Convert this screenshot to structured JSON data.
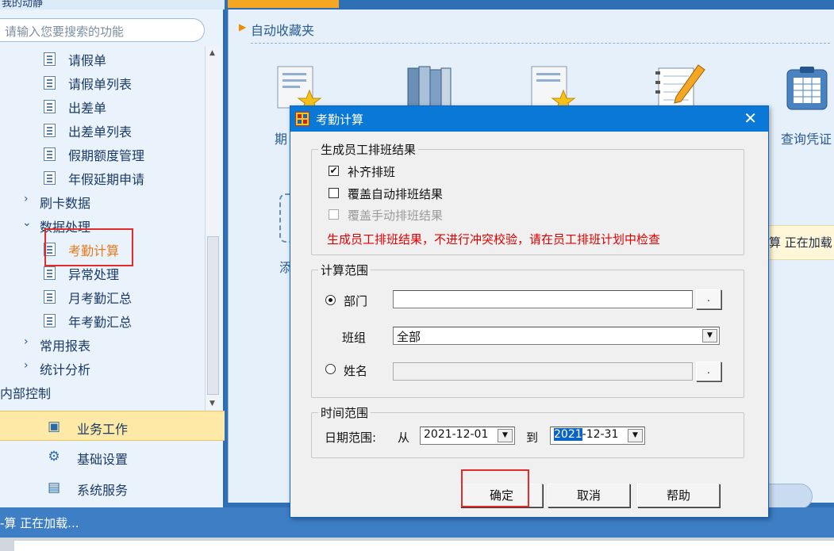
{
  "sidebar": {
    "header_text": "我的动静",
    "search_placeholder": "请输入您要搜索的功能",
    "tree": [
      {
        "label": "请假单",
        "kind": "doc"
      },
      {
        "label": "请假单列表",
        "kind": "doc"
      },
      {
        "label": "出差单",
        "kind": "doc"
      },
      {
        "label": "出差单列表",
        "kind": "doc"
      },
      {
        "label": "假期额度管理",
        "kind": "doc"
      },
      {
        "label": "年假延期申请",
        "kind": "doc"
      },
      {
        "label": "刷卡数据",
        "kind": "group"
      },
      {
        "label": "数据处理",
        "kind": "group-open"
      },
      {
        "label": "考勤计算",
        "kind": "doc",
        "selected": true
      },
      {
        "label": "异常处理",
        "kind": "doc"
      },
      {
        "label": "月考勤汇总",
        "kind": "doc"
      },
      {
        "label": "年考勤汇总",
        "kind": "doc"
      },
      {
        "label": "常用报表",
        "kind": "group"
      },
      {
        "label": "统计分析",
        "kind": "group"
      },
      {
        "label": "内部控制",
        "kind": "root"
      }
    ],
    "menu": [
      {
        "label": "业务工作",
        "icon": "org-chart-icon",
        "active": true
      },
      {
        "label": "基础设置",
        "icon": "gear-icon",
        "active": false
      },
      {
        "label": "系统服务",
        "icon": "service-icon",
        "active": false
      }
    ]
  },
  "main": {
    "favorites_title": "自动收藏夹",
    "tiles": [
      {
        "label": "期",
        "icon": "document-star-icon"
      },
      {
        "label": "",
        "icon": "books-icon"
      },
      {
        "label": "",
        "icon": "document-star-icon"
      },
      {
        "label": "",
        "icon": "notebook-pencil-icon"
      },
      {
        "label": "查询凭证",
        "icon": "clipboard-table-icon"
      }
    ],
    "add_tile_label": "添",
    "loading_text": "算 正在加载"
  },
  "status": {
    "text": "-算 正在加载..."
  },
  "dialog": {
    "title": "考勤计算",
    "close_glyph": "✕",
    "group_schedule": {
      "title": "生成员工排班结果",
      "options": [
        {
          "label": "补齐排班",
          "checked": true,
          "disabled": false
        },
        {
          "label": "覆盖自动排班结果",
          "checked": false,
          "disabled": false
        },
        {
          "label": "覆盖手动排班结果",
          "checked": false,
          "disabled": true
        }
      ],
      "warning": "生成员工排班结果，不进行冲突校验，请在员工排班计划中检查"
    },
    "group_range": {
      "title": "计算范围",
      "dept_label": "部门",
      "dept_value": "",
      "team_label": "班组",
      "team_value": "全部",
      "name_label": "姓名",
      "name_value": "",
      "ellipsis": ".",
      "dropdown_glyph": "▼"
    },
    "group_time": {
      "title": "时间范围",
      "date_range_label": "日期范围:",
      "from_label": "从",
      "from_date": "2021-12-01",
      "to_label": "到",
      "to_date_selected": "2021",
      "to_date_rest": "-12-31"
    },
    "buttons": {
      "ok": "确定",
      "cancel": "取消",
      "help": "帮助"
    }
  }
}
